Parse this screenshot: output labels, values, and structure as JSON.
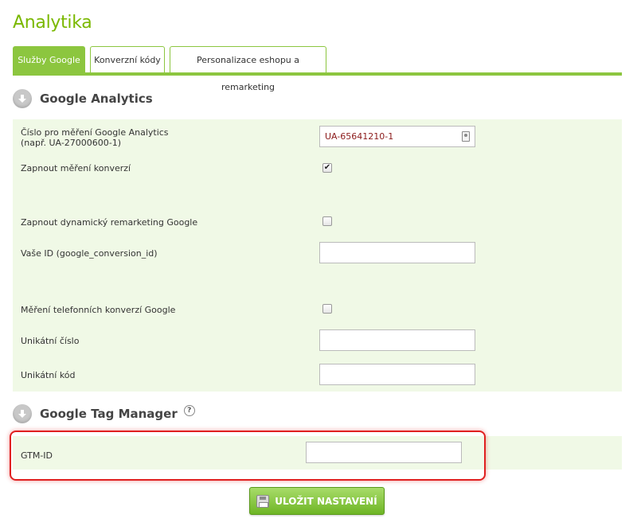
{
  "page": {
    "title": "Analytika"
  },
  "tabs": [
    {
      "label": "Služby Google",
      "active": true
    },
    {
      "label": "Konverzní kódy",
      "active": false
    },
    {
      "label": "Personalizace eshopu a remarketing",
      "active": false
    }
  ],
  "google_analytics": {
    "title": "Google Analytics",
    "measurement_label": "Číslo pro měření Google Analytics",
    "measurement_hint": "(např. UA-27000600-1)",
    "measurement_value": "UA-65641210-1",
    "conversion_label": "Zapnout měření konverzí",
    "conversion_checked": true,
    "remarketing_label": "Zapnout dynamický remarketing Google",
    "remarketing_checked": false,
    "conversion_id_label": "Vaše ID (google_conversion_id)",
    "conversion_id_value": "",
    "phone_label": "Měření telefonních konverzí Google",
    "phone_checked": false,
    "unique_number_label": "Unikátní číslo",
    "unique_number_value": "",
    "unique_code_label": "Unikátní kód",
    "unique_code_value": ""
  },
  "tag_manager": {
    "title": "Google Tag Manager",
    "help": "?",
    "gtm_label": "GTM-ID",
    "gtm_value": ""
  },
  "actions": {
    "save_label": "ULOŽIT NASTAVENÍ"
  },
  "icons": {
    "check_glyph": "✔",
    "arrow_glyph": "⬇"
  },
  "colors": {
    "accent": "#8cc63f",
    "panel_bg": "#f0f9e6",
    "highlight": "#e02020"
  }
}
